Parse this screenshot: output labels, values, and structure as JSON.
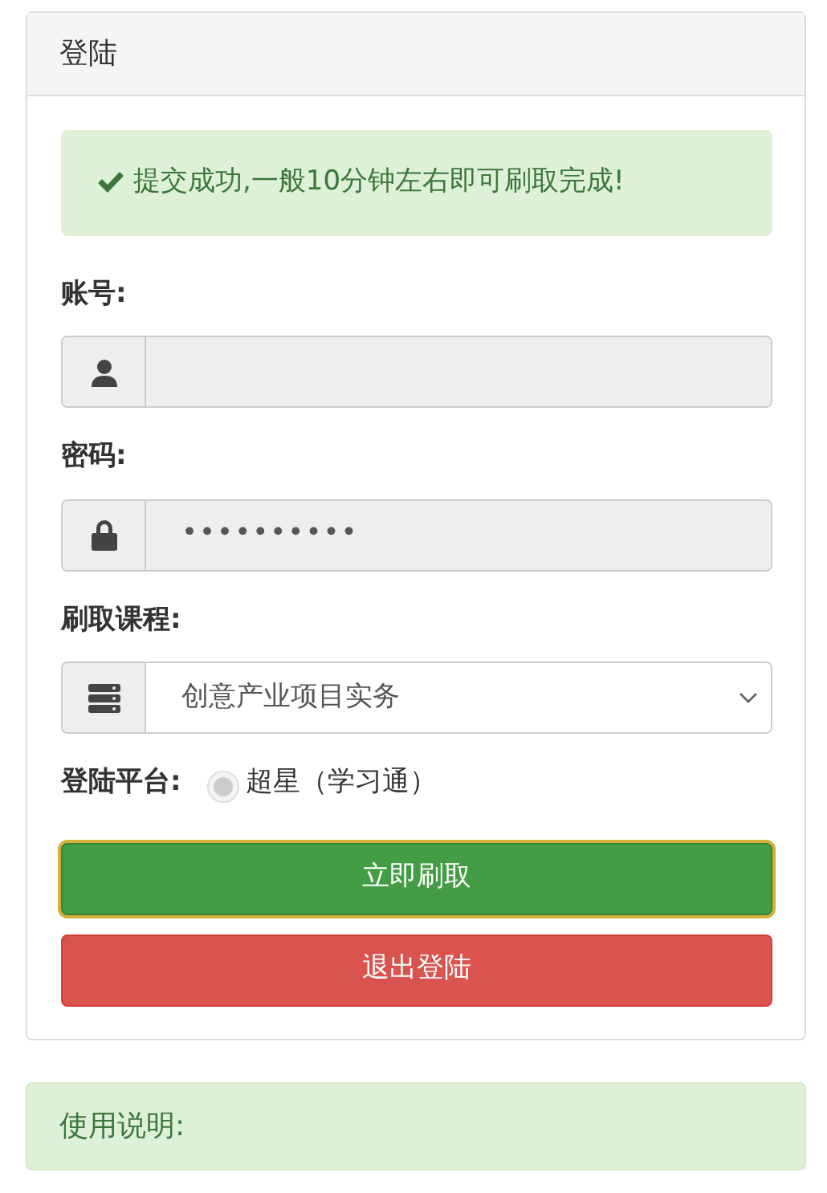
{
  "panel": {
    "title": "登陆"
  },
  "alert": {
    "text": "提交成功,一般10分钟左右即可刷取完成!"
  },
  "fields": [
    {
      "kind": "text",
      "label": "账号:",
      "disabled": true
    },
    {
      "kind": "password",
      "label": "密码:",
      "value": "••••••••••",
      "disabled": true
    },
    {
      "kind": "select",
      "label": "刷取课程:",
      "value": "创意产业项目实务",
      "disabled": false
    }
  ],
  "platform": {
    "label": "登陆平台:",
    "options": [
      {
        "label": "超星（学习通）",
        "selected": true,
        "disabled": true
      }
    ]
  },
  "buttons": [
    {
      "kind": "success",
      "label": "立即刷取",
      "focused": true
    },
    {
      "kind": "danger",
      "label": "退出登陆",
      "focused": false
    }
  ],
  "instructions": {
    "title": "使用说明:"
  }
}
